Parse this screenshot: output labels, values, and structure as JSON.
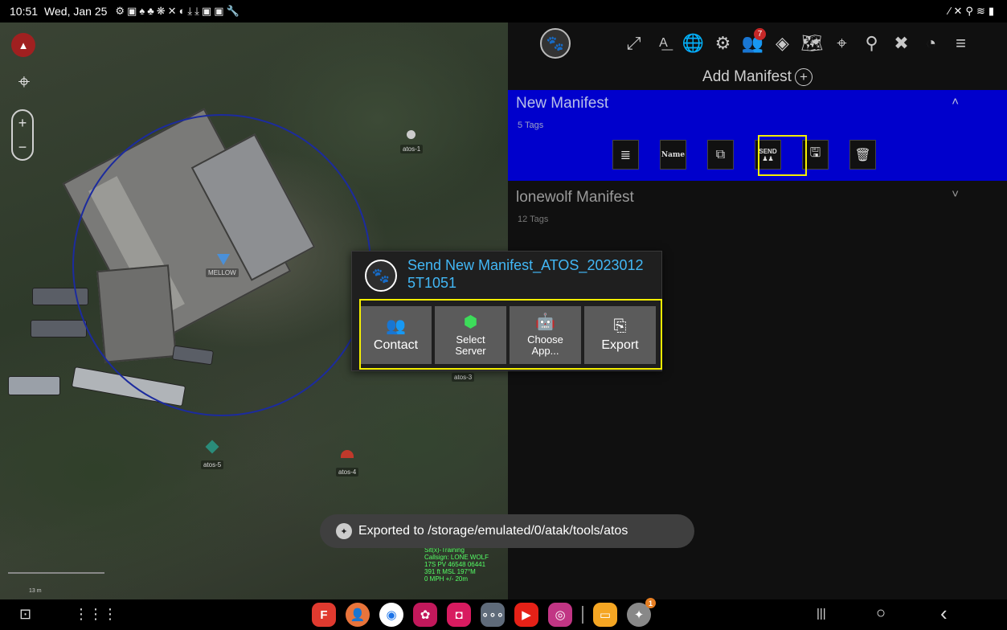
{
  "status_bar": {
    "time": "10:51",
    "date": "Wed, Jan 25",
    "notification_icons": "⚙▣♠♣❋✕◐⤓⤓▣▣🔧",
    "system_icons": "⁄✕⚲≋▮"
  },
  "map": {
    "compass": "▲",
    "locate": "⌖",
    "zoom_in": "+",
    "zoom_out": "−",
    "labels": {
      "atos1": "atos-1",
      "mellow": "MELLOW",
      "atos3": "atos-3",
      "atos4": "atos-4",
      "atos5": "atos-5"
    },
    "self_info": [
      "Sit(x)-Training",
      "Callsign: LONE WOLF",
      "17S PV 46548 06441",
      "391 ft MSL     197°M",
      "0 MPH        +/- 20m"
    ],
    "scale": "13 m"
  },
  "toolbar": {
    "badge_count": "7"
  },
  "panel": {
    "add_manifest_label": "Add Manifest",
    "add_symbol": "+",
    "manifests": [
      {
        "title": "New Manifest",
        "tags": "5 Tags",
        "chevron": "˄"
      },
      {
        "title": "lonewolf Manifest",
        "tags": "12 Tags",
        "chevron": "˅"
      }
    ],
    "actions": {
      "list": "≣",
      "name": "Name",
      "copy": "⧉",
      "send_top": "SEND",
      "send_bottom": "♟♟",
      "save": "🖫",
      "delete": "🗑"
    }
  },
  "send_dialog": {
    "title": "Send New Manifest_ATOS_20230125T1051",
    "buttons": [
      {
        "label": "Contact",
        "icon": "👥"
      },
      {
        "label": "Select Server",
        "icon": "⬢"
      },
      {
        "label": "Choose App...",
        "icon": "🤖"
      },
      {
        "label": "Export",
        "icon": "⎘"
      }
    ]
  },
  "toast": {
    "message": "Exported to /storage/emulated/0/atak/tools/atos"
  },
  "nav": {
    "dock_badge": "1",
    "recents": "|||",
    "home": "○",
    "back": "‹"
  },
  "colors": {
    "selected_manifest_bg": "#0000cc",
    "highlight": "#f5ef00",
    "dialog_title": "#42b7f5",
    "range_ring": "#1c2b9e"
  }
}
